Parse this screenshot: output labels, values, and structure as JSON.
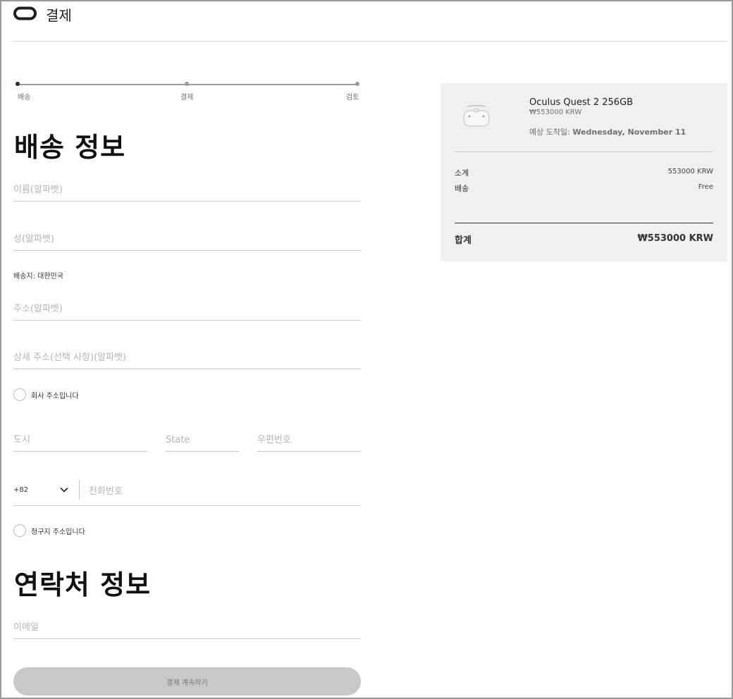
{
  "header": {
    "title": "결제"
  },
  "stepper": {
    "steps": [
      "배송",
      "결제",
      "검토"
    ]
  },
  "shipping": {
    "section_title": "배송 정보",
    "first_name_placeholder": "이름(알파벳)",
    "last_name_placeholder": "성(알파벳)",
    "country_label": "배송지: 대한민국",
    "address_placeholder": "주소(알파벳)",
    "address2_placeholder": "상세 주소(선택 사항)(알파벳)",
    "company_checkbox_label": "회사 주소입니다",
    "city_placeholder": "도시",
    "state_placeholder": "State",
    "postal_placeholder": "우편번호",
    "phone_code": "+82",
    "phone_placeholder": "전화번호",
    "billing_checkbox_label": "청구지 주소입니다"
  },
  "contact": {
    "section_title": "연락처 정보",
    "email_placeholder": "이메일",
    "continue_label": "결제 계속하기"
  },
  "summary": {
    "product_name": "Oculus Quest 2 256GB",
    "product_price": "₩553000 KRW",
    "eta_label": "예상 도착일:",
    "eta_date": "Wednesday, November 11",
    "subtotal_label": "소계",
    "subtotal_value": "553000 KRW",
    "shipping_label": "배송",
    "shipping_value": "Free",
    "total_label": "합계",
    "total_value": "₩553000 KRW"
  },
  "colors": {
    "accent": "#1c2b4a",
    "button_disabled": "#c8c8c8",
    "summary_bg": "#f0f0f0"
  }
}
